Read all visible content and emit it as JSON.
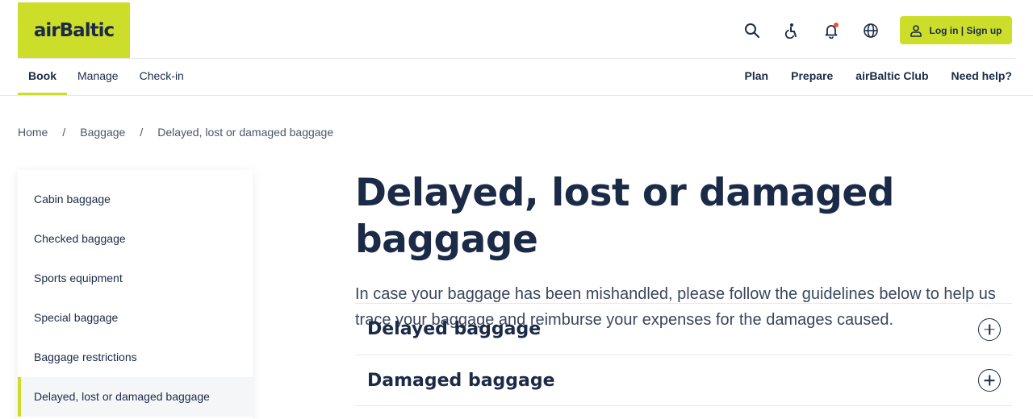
{
  "brand": {
    "logo_text": "airBaltic",
    "accent_color": "#cdde2a",
    "notification_color": "#e8513c"
  },
  "header": {
    "icons": [
      "search-icon",
      "accessibility-icon",
      "bell-icon",
      "globe-icon"
    ],
    "login_label": "Log in | Sign up"
  },
  "nav": {
    "left": [
      {
        "label": "Book",
        "active": true
      },
      {
        "label": "Manage"
      },
      {
        "label": "Check-in"
      }
    ],
    "right": [
      "Plan",
      "Prepare",
      "airBaltic Club",
      "Need help?"
    ]
  },
  "breadcrumb": {
    "items": [
      "Home",
      "Baggage",
      "Delayed, lost or damaged baggage"
    ],
    "separator": "/"
  },
  "sidebar": {
    "items": [
      "Cabin baggage",
      "Checked baggage",
      "Sports equipment",
      "Special baggage",
      "Baggage restrictions",
      "Delayed, lost or damaged baggage"
    ],
    "active_index": 5
  },
  "main": {
    "title": "Delayed, lost or damaged baggage",
    "intro": "In case your baggage has been mishandled, please follow the guidelines below to help us trace your baggage and reimburse your expenses for the damages caused.",
    "accordion": [
      "Delayed baggage",
      "Damaged baggage"
    ]
  }
}
